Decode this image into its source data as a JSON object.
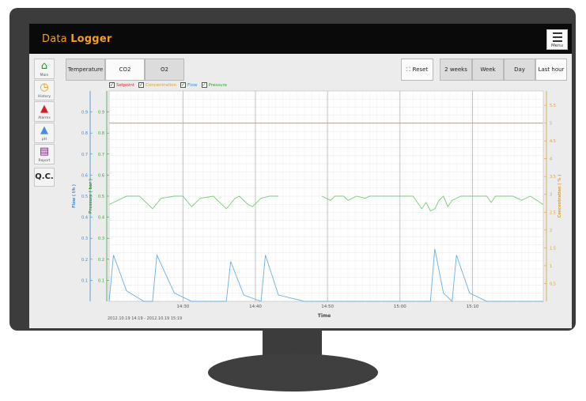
{
  "header": {
    "title_plain": "Data",
    "title_bold": "Logger",
    "menu_label": "Menu"
  },
  "sidebar": {
    "items": [
      {
        "label": "Main",
        "icon": "house-icon",
        "glyph": "⌂",
        "color": "#2e8b3a"
      },
      {
        "label": "History",
        "icon": "clock-icon",
        "glyph": "◷",
        "color": "#d89a10"
      },
      {
        "label": "Alarms",
        "icon": "bell-icon",
        "glyph": "▲",
        "color": "#d02020"
      },
      {
        "label": "pH",
        "icon": "flask-icon",
        "glyph": "▲",
        "color": "#4a8ae0"
      },
      {
        "label": "Report",
        "icon": "report-icon",
        "glyph": "▤",
        "color": "#7a2a7a"
      }
    ],
    "qc_label": "Q.C."
  },
  "tabs": [
    "Temperature",
    "CO2",
    "O2"
  ],
  "active_tab": "CO2",
  "reset_label": "Reset",
  "ranges": [
    "2 weeks",
    "Week",
    "Day",
    "Last hour"
  ],
  "legend": [
    {
      "label": "Setpoint",
      "color": "#d03030"
    },
    {
      "label": "Concentration",
      "color": "#d8a030"
    },
    {
      "label": "Flow",
      "color": "#3a8ad0"
    },
    {
      "label": "Pressure",
      "color": "#3aa040"
    }
  ],
  "colors": {
    "setpoint": "#d03030",
    "concentration": "#e0a030",
    "flow": "#6aaee0",
    "pressure": "#7ec87e"
  },
  "chart_data": {
    "type": "line",
    "xlabel": "Time",
    "x_ticks": [
      "14:30",
      "14:40",
      "14:50",
      "15:00",
      "15:10"
    ],
    "x_range_minutes": [
      14.33,
      15.33
    ],
    "date_range": {
      "start_date": "2012.10.19",
      "start_time": "14:19",
      "sep": "-",
      "end_date": "2012.10.19",
      "end_time": "15:19"
    },
    "y_axes": [
      {
        "label": "Flow ( l/h )",
        "ticks": [
          "0.1",
          "0.2",
          "0.3",
          "0.4",
          "0.5",
          "0.6",
          "0.7",
          "0.8",
          "0.9"
        ],
        "ylim": [
          0,
          1.0
        ],
        "color": "#3a8ad0"
      },
      {
        "label": "Pressure ( bar )",
        "ticks": [
          "0.1",
          "0.2",
          "0.3",
          "0.4",
          "0.5",
          "0.6",
          "0.7",
          "0.8",
          "0.9"
        ],
        "ylim": [
          0,
          1.0
        ],
        "color": "#3aa040"
      },
      {
        "label": "Concentration ( % )",
        "ticks": [
          "0.5",
          "1",
          "1.5",
          "2",
          "2.5",
          "3",
          "3.5",
          "4",
          "4.5",
          "5",
          "5.5"
        ],
        "ylim": [
          0,
          5.9
        ],
        "color": "#d8a030"
      }
    ],
    "series": [
      {
        "name": "Setpoint",
        "axis": "Concentration ( % )",
        "constant": 5.0
      },
      {
        "name": "Pressure",
        "axis": "Pressure ( bar )",
        "segments": [
          {
            "x": [
              14.33,
              14.35,
              14.37,
              14.38,
              14.4,
              14.43,
              14.45,
              14.48,
              14.5,
              14.52,
              14.54,
              14.57
            ],
            "y": [
              0.46,
              0.48,
              0.5,
              0.5,
              0.5,
              0.44,
              0.49,
              0.5,
              0.5,
              0.45,
              0.49,
              0.5
            ]
          },
          {
            "x": [
              14.57,
              14.6,
              14.62,
              14.63,
              14.65,
              14.66,
              14.68,
              14.7,
              14.72
            ],
            "y": [
              0.5,
              0.44,
              0.49,
              0.5,
              0.46,
              0.45,
              0.49,
              0.5,
              0.5
            ]
          },
          {
            "x": [
              14.82,
              14.83,
              14.84,
              14.85,
              14.87,
              14.88,
              14.9,
              14.92,
              14.93,
              14.95,
              14.97,
              15.0,
              15.03,
              15.04,
              15.05,
              15.06,
              15.07,
              15.08,
              15.09,
              15.1,
              15.11,
              15.12,
              15.14,
              15.17,
              15.2,
              15.21,
              15.22,
              15.24,
              15.26,
              15.28,
              15.3,
              15.33
            ],
            "y": [
              0.5,
              0.49,
              0.48,
              0.5,
              0.5,
              0.48,
              0.5,
              0.49,
              0.5,
              0.5,
              0.5,
              0.5,
              0.5,
              0.47,
              0.44,
              0.47,
              0.43,
              0.44,
              0.48,
              0.5,
              0.45,
              0.48,
              0.5,
              0.5,
              0.5,
              0.47,
              0.5,
              0.5,
              0.5,
              0.48,
              0.5,
              0.46
            ]
          }
        ]
      },
      {
        "name": "Flow",
        "axis": "Flow ( l/h )",
        "x": [
          14.33,
          14.34,
          14.37,
          14.41,
          14.43,
          14.44,
          14.48,
          14.52,
          14.56,
          14.6,
          14.61,
          14.64,
          14.68,
          14.69,
          14.72,
          14.78,
          14.82,
          14.88,
          14.94,
          14.98,
          15.04,
          15.07,
          15.08,
          15.1,
          15.12,
          15.13,
          15.16,
          15.2,
          15.26,
          15.33
        ],
        "y": [
          0.0,
          0.22,
          0.05,
          0.0,
          0.0,
          0.22,
          0.04,
          0.0,
          0.0,
          0.0,
          0.19,
          0.03,
          0.0,
          0.22,
          0.03,
          0.0,
          0.0,
          0.0,
          0.0,
          0.0,
          0.0,
          0.0,
          0.25,
          0.04,
          0.0,
          0.22,
          0.04,
          0.0,
          0.0,
          0.0
        ]
      }
    ]
  }
}
